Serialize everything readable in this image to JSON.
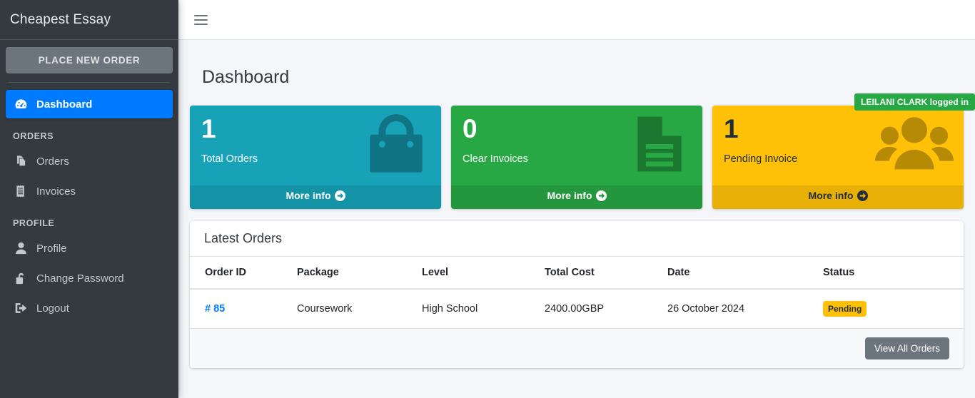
{
  "sidebar": {
    "brand": "Cheapest Essay",
    "place_order_label": "PLACE NEW ORDER",
    "active_item": {
      "label": "Dashboard",
      "icon": "tachometer-icon"
    },
    "sections": [
      {
        "header": "ORDERS",
        "items": [
          {
            "label": "Orders",
            "icon": "copy-files-icon"
          },
          {
            "label": "Invoices",
            "icon": "receipt-icon"
          }
        ]
      },
      {
        "header": "PROFILE",
        "items": [
          {
            "label": "Profile",
            "icon": "user-icon"
          },
          {
            "label": "Change Password",
            "icon": "unlock-icon"
          },
          {
            "label": "Logout",
            "icon": "sign-out-icon"
          }
        ]
      }
    ]
  },
  "navbar": {
    "menu_toggle_icon": "hamburger-icon"
  },
  "header": {
    "page_title": "Dashboard",
    "logged_in_badge": "LEILANI CLARK logged in",
    "logged_in_badge_color": "#28a745"
  },
  "stat_cards": [
    {
      "number": "1",
      "label": "Total Orders",
      "footer_label": "More info",
      "icon": "shopping-bag-icon",
      "color": "#17a2b8"
    },
    {
      "number": "0",
      "label": "Clear Invoices",
      "footer_label": "More info",
      "icon": "document-lines-icon",
      "color": "#28a745"
    },
    {
      "number": "1",
      "label": "Pending Invoice",
      "footer_label": "More info",
      "icon": "users-group-icon",
      "color": "#ffc107"
    }
  ],
  "latest_orders": {
    "title": "Latest Orders",
    "columns": [
      "Order ID",
      "Package",
      "Level",
      "Total Cost",
      "Date",
      "Status"
    ],
    "rows": [
      {
        "order_id": "# 85",
        "package": "Coursework",
        "level": "High School",
        "total_cost": "2400.00GBP",
        "date": "26 October 2024",
        "status": "Pending",
        "status_color": "#ffc107"
      }
    ],
    "view_all_label": "View All Orders"
  }
}
